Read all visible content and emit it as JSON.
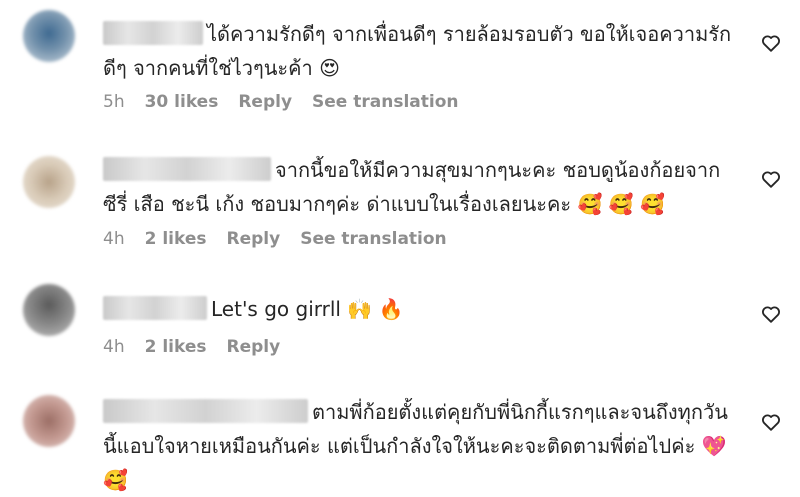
{
  "comments": [
    {
      "text": "ได้ความรักดีๆ จากเพื่อนดีๆ รายล้อมรอบตัว ขอให้เจอความรักดีๆ จากคนที่ใช่ไวๆนะค้า 😍",
      "time": "5h",
      "likes": "30 likes",
      "reply": "Reply",
      "translate": "See translation"
    },
    {
      "text": "จากนี้ขอให้มีความสุขมากๆนะคะ ชอบดูน้องก้อยจากซีรี่ เสือ ชะนี เก้ง ชอบมากๆค่ะ ด่าแบบในเรื่องเลยนะคะ 🥰 🥰 🥰",
      "time": "4h",
      "likes": "2 likes",
      "reply": "Reply",
      "translate": "See translation"
    },
    {
      "text": "Let's go girrll 🙌 🔥",
      "time": "4h",
      "likes": "2 likes",
      "reply": "Reply"
    },
    {
      "text": "ตามพี่ก้อยตั้งแต่คุยกับพี่นิกกี้แรกๆและจนถึงทุกวันนี้แอบใจหายเหมือนกันค่ะ แต่เป็นกำลังใจให้นะคะจะติดตามพี่ต่อไปค่ะ 💖 🥰"
    }
  ],
  "colors": {
    "text": "#262626",
    "meta": "#8e8e8e",
    "background": "#ffffff"
  },
  "icons": {
    "like": "heart-outline-icon"
  }
}
